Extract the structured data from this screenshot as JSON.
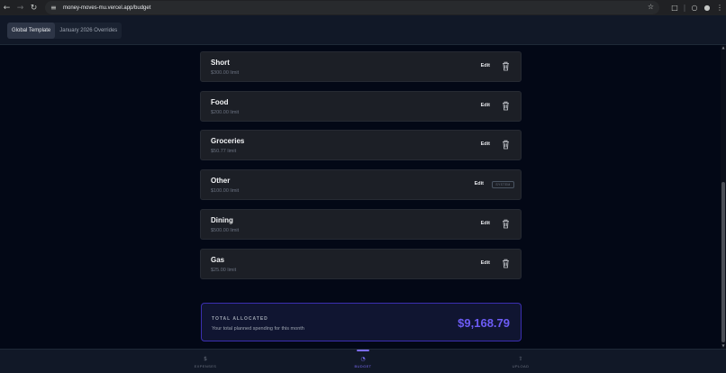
{
  "browser": {
    "url": "money-moves-mu.vercel.app/budget",
    "back_icon": "arrow-left-icon",
    "forward_icon": "arrow-right-icon",
    "reload_icon": "reload-icon"
  },
  "header": {
    "tabs": [
      {
        "label": "Global Template",
        "active": true
      },
      {
        "label": "January 2026 Overrides",
        "active": false
      }
    ]
  },
  "categories": [
    {
      "name": "Short",
      "limit": "$300.00 limit",
      "edit_label": "Edit",
      "delete_icon": "trash-icon"
    },
    {
      "name": "Food",
      "limit": "$200.00 limit",
      "edit_label": "Edit",
      "delete_icon": "trash-icon"
    },
    {
      "name": "Groceries",
      "limit": "$50.77 limit",
      "edit_label": "Edit",
      "delete_icon": "trash-icon"
    },
    {
      "name": "Other",
      "limit": "$100.00 limit",
      "edit_label": "Edit",
      "badge": "SYSTEM"
    },
    {
      "name": "Dining",
      "limit": "$500.00 limit",
      "edit_label": "Edit",
      "delete_icon": "trash-icon"
    },
    {
      "name": "Gas",
      "limit": "$25.00 limit",
      "edit_label": "Edit",
      "delete_icon": "trash-icon"
    }
  ],
  "total": {
    "label": "TOTAL ALLOCATED",
    "subtitle": "Your total planned spending for this month",
    "amount": "$9,168.79",
    "accent_color": "#6d5cf6"
  },
  "bottom_nav": {
    "items": [
      {
        "label": "EXPENSES",
        "icon": "dollar-icon",
        "active": false
      },
      {
        "label": "BUDGET",
        "icon": "budget-icon",
        "active": true
      },
      {
        "label": "UPLOAD",
        "icon": "upload-icon",
        "active": false
      }
    ]
  }
}
